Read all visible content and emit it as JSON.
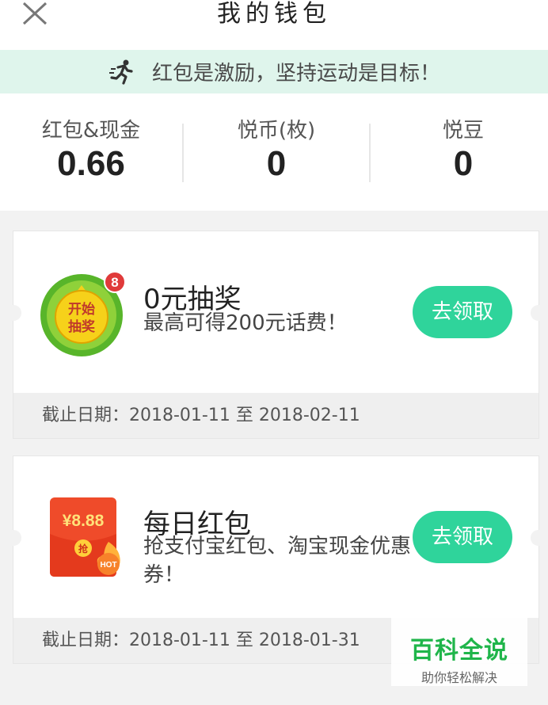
{
  "header": {
    "title": "我的钱包"
  },
  "slogan": "红包是激励，坚持运动是目标！",
  "stats": [
    {
      "label": "红包&现金",
      "value": "0.66"
    },
    {
      "label": "悦币(枚)",
      "value": "0"
    },
    {
      "label": "悦豆",
      "value": "0"
    }
  ],
  "cards": [
    {
      "title": "0元抽奖",
      "desc": "最高可得200元话费！",
      "button": "去领取",
      "deadline": "截止日期：2018-01-11 至 2018-02-11",
      "icon": {
        "line1": "开始",
        "line2": "抽奖",
        "badge": "8"
      }
    },
    {
      "title": "每日红包",
      "desc": "抢支付宝红包、淘宝现金优惠券！",
      "button": "去领取",
      "deadline": "截止日期：2018-01-11 至 2018-01-31",
      "icon": {
        "amount": "¥8.88",
        "grab": "抢",
        "hot": "HOT"
      }
    }
  ],
  "watermark": {
    "title": "百科全说",
    "subtitle": "助你轻松解决"
  },
  "colors": {
    "accent": "#2fd49b",
    "slogan_bg": "#dff5ec",
    "watermark_green": "#1fb54a"
  }
}
